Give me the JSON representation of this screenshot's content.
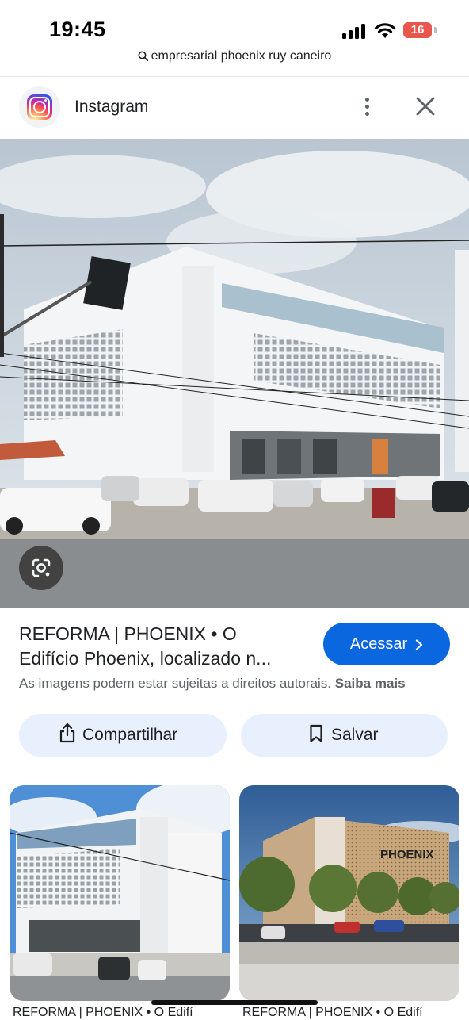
{
  "status": {
    "time": "19:45",
    "battery": "16"
  },
  "url_bar": {
    "query": "empresarial phoenix ruy caneiro"
  },
  "header": {
    "site_name": "Instagram"
  },
  "result": {
    "title_line1": "REFORMA | PHOENIX • O",
    "title_line2": "Edifício Phoenix, localizado n...",
    "visit_label": "Acessar",
    "copyright_text": "As imagens podem estar sujeitas a direitos autorais.",
    "learn_more": "Saiba mais"
  },
  "actions": {
    "share_label": "Compartilhar",
    "save_label": "Salvar"
  },
  "related": [
    {
      "caption": "REFORMA | PHOENIX • O Edifí"
    },
    {
      "caption": "REFORMA | PHOENIX • O Edifí"
    }
  ],
  "thumb2_sign": "PHOENIX",
  "colors": {
    "accent": "#0b67df",
    "action_bg": "#e8f0fe",
    "battery": "#e8574d"
  },
  "icons": [
    "search-icon",
    "signal-icon",
    "wifi-icon",
    "battery-icon",
    "instagram-icon",
    "more-vert-icon",
    "close-icon",
    "lens-icon",
    "chevron-right-icon",
    "share-icon",
    "bookmark-icon"
  ]
}
